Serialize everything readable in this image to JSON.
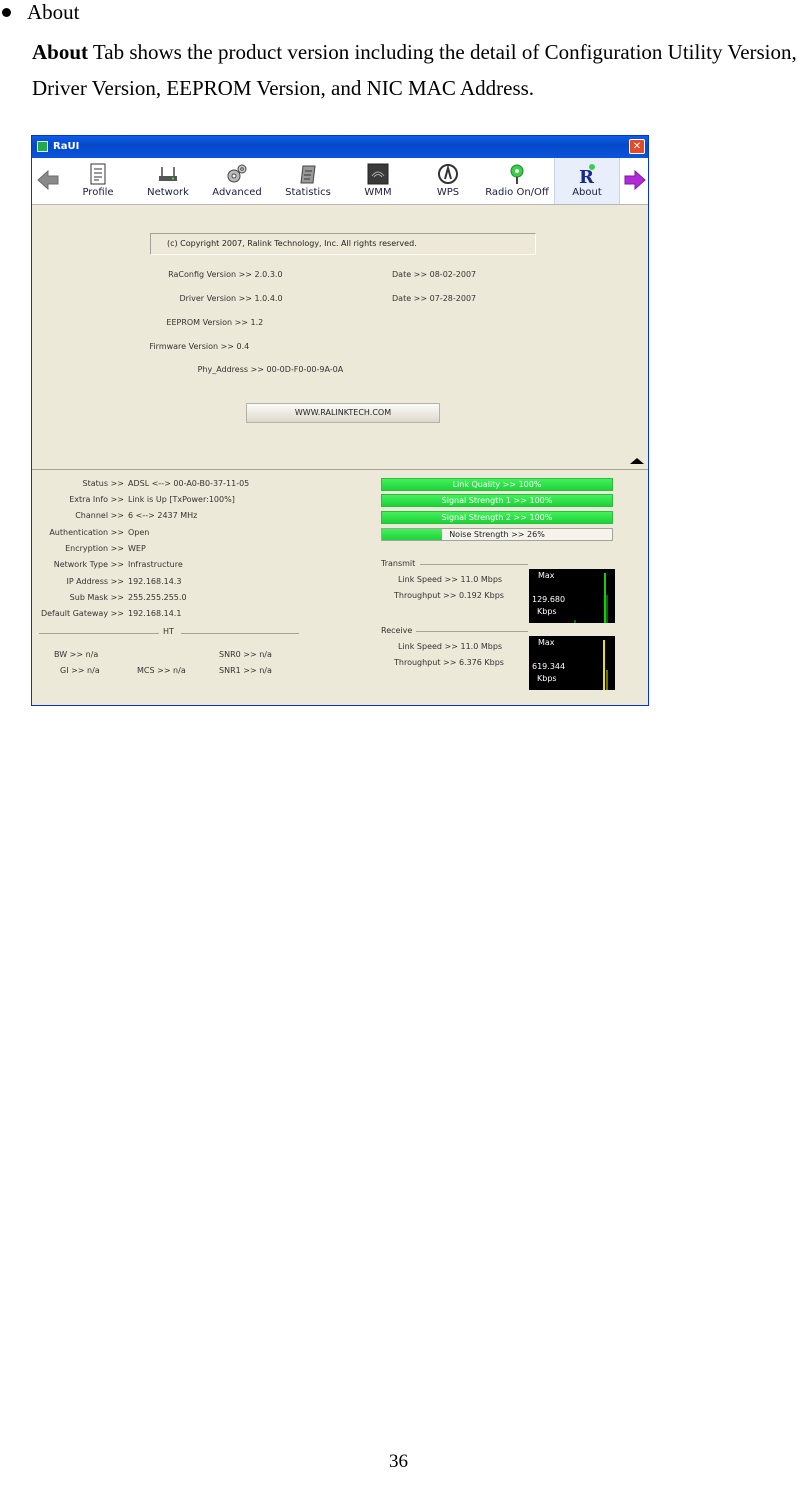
{
  "doc": {
    "bullet": "About",
    "para_bold": "About",
    "para_rest": " Tab shows the product version including the detail of Configuration Utility Version, Driver Version, EEPROM Version, and NIC MAC Address.",
    "page_number": "36"
  },
  "window": {
    "title": "RaUI",
    "close_glyph": "✕",
    "toolbar": [
      {
        "label": "Profile",
        "icon": "profile-icon"
      },
      {
        "label": "Network",
        "icon": "network-icon"
      },
      {
        "label": "Advanced",
        "icon": "advanced-icon"
      },
      {
        "label": "Statistics",
        "icon": "statistics-icon"
      },
      {
        "label": "WMM",
        "icon": "wmm-icon"
      },
      {
        "label": "WPS",
        "icon": "wps-icon"
      },
      {
        "label": "Radio On/Off",
        "icon": "radio-icon"
      },
      {
        "label": "About",
        "icon": "about-icon",
        "active": true
      }
    ],
    "about": {
      "copyright": "(c) Copyright 2007, Ralink Technology, Inc.  All rights reserved.",
      "raconfig_label": "RaConfig Version >>",
      "raconfig_value": "2.0.3.0",
      "raconfig_date_label": "Date >>",
      "raconfig_date": "08-02-2007",
      "driver_label": "Driver Version >>",
      "driver_value": "1.0.4.0",
      "driver_date_label": "Date >>",
      "driver_date": "07-28-2007",
      "eeprom_label": "EEPROM Version >>",
      "eeprom_value": "1.2",
      "firmware_label": "Firmware Version >>",
      "firmware_value": "0.4",
      "phy_label": "Phy_Address >>",
      "phy_value": "00-0D-F0-00-9A-0A",
      "website": "WWW.RALINKTECH.COM"
    },
    "status": {
      "rows": [
        {
          "key": "Status >>",
          "value": "ADSL <--> 00-A0-B0-37-11-05"
        },
        {
          "key": "Extra Info >>",
          "value": "Link is Up [TxPower:100%]"
        },
        {
          "key": "Channel >>",
          "value": "6 <--> 2437 MHz"
        },
        {
          "key": "Authentication >>",
          "value": "Open"
        },
        {
          "key": "Encryption >>",
          "value": "WEP"
        },
        {
          "key": "Network Type >>",
          "value": "Infrastructure"
        },
        {
          "key": "IP Address >>",
          "value": "192.168.14.3"
        },
        {
          "key": "Sub Mask >>",
          "value": "255.255.255.0"
        },
        {
          "key": "Default Gateway >>",
          "value": "192.168.14.1"
        }
      ],
      "ht_title": "HT",
      "bw": "BW >> n/a",
      "gi": "GI >> n/a",
      "mcs": "MCS >> n/a",
      "snr0": "SNR0 >> n/a",
      "snr1": "SNR1 >> n/a"
    },
    "signal": {
      "link_quality": "Link Quality >> 100%",
      "link_quality_pct": 100,
      "signal1": "Signal Strength 1 >> 100%",
      "signal1_pct": 100,
      "signal2": "Signal Strength 2 >> 100%",
      "signal2_pct": 100,
      "noise": "Noise Strength >> 26%",
      "noise_pct": 26
    },
    "transmit": {
      "title": "Transmit",
      "link_speed": "Link Speed >> 11.0 Mbps",
      "throughput": "Throughput >> 0.192 Kbps",
      "graph_max": "Max",
      "graph_value": "129.680",
      "graph_unit": "Kbps",
      "graph_color": "#18c818"
    },
    "receive": {
      "title": "Receive",
      "link_speed": "Link Speed >> 11.0 Mbps",
      "throughput": "Throughput >> 6.376 Kbps",
      "graph_max": "Max",
      "graph_value": "619.344",
      "graph_unit": "Kbps",
      "graph_color": "#e8e018"
    }
  }
}
